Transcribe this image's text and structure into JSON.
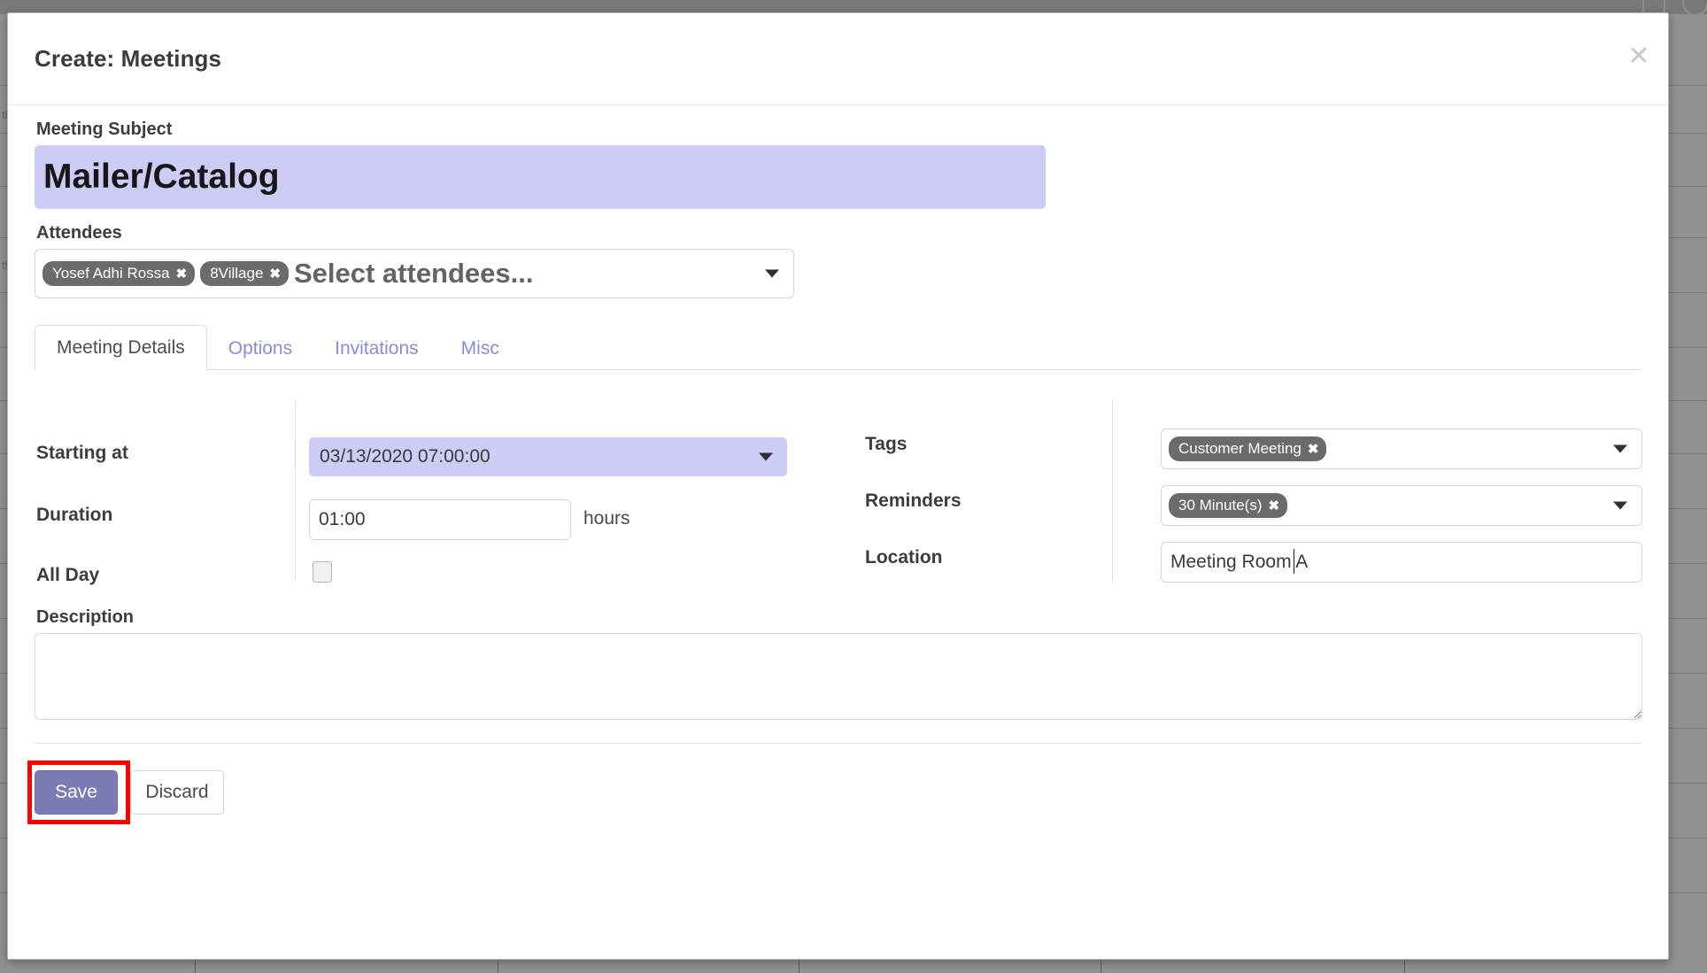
{
  "modal": {
    "title": "Create: Meetings",
    "close_icon": "close-icon"
  },
  "subject": {
    "label": "Meeting Subject",
    "value": "Mailer/Catalog",
    "placeholder": "Meeting Subject"
  },
  "attendees": {
    "label": "Attendees",
    "placeholder": "Select attendees...",
    "chips": [
      {
        "label": "Yosef Adhi Rossa",
        "remove_icon": "✖"
      },
      {
        "label": "8Village",
        "remove_icon": "✖"
      }
    ],
    "caret_icon": "chevron-down-icon"
  },
  "tabs": [
    {
      "label": "Meeting Details",
      "active": true
    },
    {
      "label": "Options",
      "active": false
    },
    {
      "label": "Invitations",
      "active": false
    },
    {
      "label": "Misc",
      "active": false
    }
  ],
  "details": {
    "starting_at": {
      "label": "Starting at",
      "value": "03/13/2020 07:00:00",
      "caret_icon": "chevron-down-icon"
    },
    "duration": {
      "label": "Duration",
      "value": "01:00",
      "placeholder": "01:00",
      "unit": "hours"
    },
    "all_day": {
      "label": "All Day",
      "checked": false
    },
    "tags": {
      "label": "Tags",
      "chips": [
        {
          "label": "Customer Meeting",
          "remove_icon": "✖"
        }
      ],
      "caret_icon": "chevron-down-icon"
    },
    "reminders": {
      "label": "Reminders",
      "chips": [
        {
          "label": "30 Minute(s)",
          "remove_icon": "✖"
        }
      ],
      "caret_icon": "chevron-down-icon"
    },
    "location": {
      "label": "Location",
      "value": "Meeting Room A",
      "placeholder": "Location"
    }
  },
  "description": {
    "label": "Description",
    "value": "",
    "placeholder": ""
  },
  "footer": {
    "save_label": "Save",
    "discard_label": "Discard"
  },
  "colors": {
    "accent_field": "#ccccf6",
    "save_button": "#7b7bb5",
    "chip": "#6b6b6b",
    "tab_inactive": "#8a8ae0",
    "highlight_box": "#ff0000",
    "overlay": "#6f6f6f"
  }
}
